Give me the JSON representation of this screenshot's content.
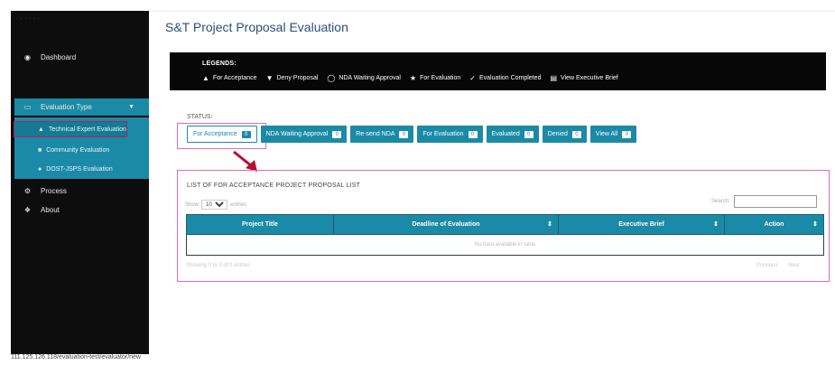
{
  "sidebar": {
    "brand": "· · · · ·",
    "dashboard": {
      "label": "Dashboard",
      "icon": "gauge-icon"
    },
    "evaluation_type": {
      "label": "Evaluation Type",
      "icon": "folder-icon"
    },
    "sub_items": [
      {
        "label": "Technical Expert Evaluation",
        "icon": "user-icon"
      },
      {
        "label": "Community Evaluation",
        "icon": "community-icon"
      },
      {
        "label": "DOST-JSPS Evaluation",
        "icon": "globe-icon"
      }
    ],
    "process": {
      "label": "Process",
      "icon": "cogs-icon"
    },
    "about": {
      "label": "About",
      "icon": "info-icon"
    }
  },
  "page": {
    "title": "S&T Project Proposal Evaluation"
  },
  "legend": {
    "title": "LEGENDS:",
    "items": [
      {
        "label": "For Acceptance",
        "icon": "thumbs-up-icon"
      },
      {
        "label": "Deny Proposal",
        "icon": "thumbs-down-icon"
      },
      {
        "label": "NDA Waiting Approval",
        "icon": "hourglass-icon"
      },
      {
        "label": "For Evaluation",
        "icon": "star-icon"
      },
      {
        "label": "Evaluation Completed",
        "icon": "check-icon"
      },
      {
        "label": "View Executive Brief",
        "icon": "document-icon"
      }
    ]
  },
  "status": {
    "label": "STATUS:",
    "buttons": [
      {
        "label": "For Acceptance",
        "count": "0"
      },
      {
        "label": "NDA Waiting Approval",
        "count": "0"
      },
      {
        "label": "Re-send NDA",
        "count": "0"
      },
      {
        "label": "For Evaluation",
        "count": "0"
      },
      {
        "label": "Evaluated",
        "count": "0"
      },
      {
        "label": "Denied",
        "count": "0"
      },
      {
        "label": "View All",
        "count": "0"
      }
    ]
  },
  "list": {
    "title": "LIST OF FOR ACCEPTANCE PROJECT PROPOSAL LIST",
    "show_label": "Show",
    "entries_value": "10",
    "entries_label": "entries",
    "search_label": "Search:",
    "columns": [
      "Project Title",
      "Deadline of Evaluation",
      "Executive Brief",
      "Action"
    ],
    "empty_message": "No data available in table",
    "info": "Showing 0 to 0 of 0 entries",
    "prev": "Previous",
    "next": "Next"
  },
  "url": "111.125.126.118/evaluation-test/evaluator/new",
  "colors": {
    "accent": "#1b8aa6",
    "sidebar_bg": "#0d0d0d",
    "legend_bg": "#070707",
    "title": "#2e4d7b",
    "highlight": "#e06bbf"
  }
}
